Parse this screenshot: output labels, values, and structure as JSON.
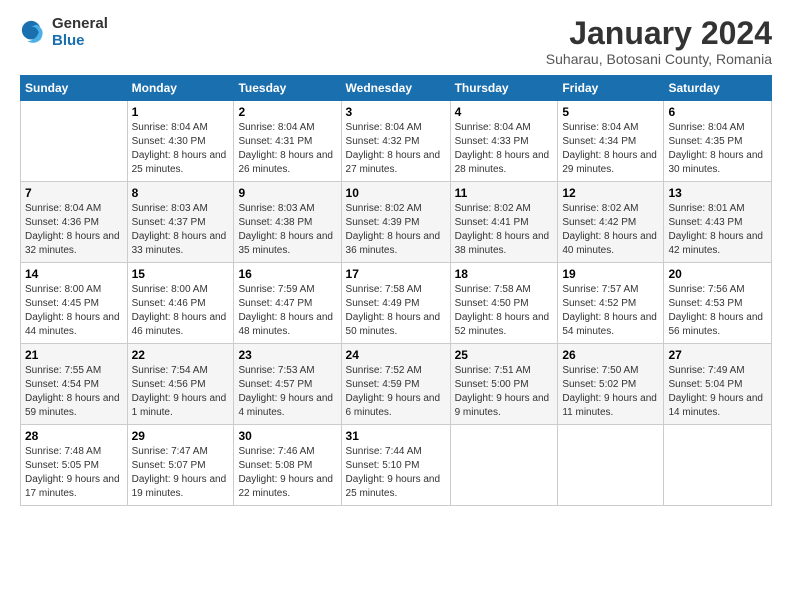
{
  "logo": {
    "general": "General",
    "blue": "Blue"
  },
  "header": {
    "month_year": "January 2024",
    "location": "Suharau, Botosani County, Romania"
  },
  "weekdays": [
    "Sunday",
    "Monday",
    "Tuesday",
    "Wednesday",
    "Thursday",
    "Friday",
    "Saturday"
  ],
  "weeks": [
    [
      {
        "day": "",
        "sunrise": "",
        "sunset": "",
        "daylight": ""
      },
      {
        "day": "1",
        "sunrise": "Sunrise: 8:04 AM",
        "sunset": "Sunset: 4:30 PM",
        "daylight": "Daylight: 8 hours and 25 minutes."
      },
      {
        "day": "2",
        "sunrise": "Sunrise: 8:04 AM",
        "sunset": "Sunset: 4:31 PM",
        "daylight": "Daylight: 8 hours and 26 minutes."
      },
      {
        "day": "3",
        "sunrise": "Sunrise: 8:04 AM",
        "sunset": "Sunset: 4:32 PM",
        "daylight": "Daylight: 8 hours and 27 minutes."
      },
      {
        "day": "4",
        "sunrise": "Sunrise: 8:04 AM",
        "sunset": "Sunset: 4:33 PM",
        "daylight": "Daylight: 8 hours and 28 minutes."
      },
      {
        "day": "5",
        "sunrise": "Sunrise: 8:04 AM",
        "sunset": "Sunset: 4:34 PM",
        "daylight": "Daylight: 8 hours and 29 minutes."
      },
      {
        "day": "6",
        "sunrise": "Sunrise: 8:04 AM",
        "sunset": "Sunset: 4:35 PM",
        "daylight": "Daylight: 8 hours and 30 minutes."
      }
    ],
    [
      {
        "day": "7",
        "sunrise": "Sunrise: 8:04 AM",
        "sunset": "Sunset: 4:36 PM",
        "daylight": "Daylight: 8 hours and 32 minutes."
      },
      {
        "day": "8",
        "sunrise": "Sunrise: 8:03 AM",
        "sunset": "Sunset: 4:37 PM",
        "daylight": "Daylight: 8 hours and 33 minutes."
      },
      {
        "day": "9",
        "sunrise": "Sunrise: 8:03 AM",
        "sunset": "Sunset: 4:38 PM",
        "daylight": "Daylight: 8 hours and 35 minutes."
      },
      {
        "day": "10",
        "sunrise": "Sunrise: 8:02 AM",
        "sunset": "Sunset: 4:39 PM",
        "daylight": "Daylight: 8 hours and 36 minutes."
      },
      {
        "day": "11",
        "sunrise": "Sunrise: 8:02 AM",
        "sunset": "Sunset: 4:41 PM",
        "daylight": "Daylight: 8 hours and 38 minutes."
      },
      {
        "day": "12",
        "sunrise": "Sunrise: 8:02 AM",
        "sunset": "Sunset: 4:42 PM",
        "daylight": "Daylight: 8 hours and 40 minutes."
      },
      {
        "day": "13",
        "sunrise": "Sunrise: 8:01 AM",
        "sunset": "Sunset: 4:43 PM",
        "daylight": "Daylight: 8 hours and 42 minutes."
      }
    ],
    [
      {
        "day": "14",
        "sunrise": "Sunrise: 8:00 AM",
        "sunset": "Sunset: 4:45 PM",
        "daylight": "Daylight: 8 hours and 44 minutes."
      },
      {
        "day": "15",
        "sunrise": "Sunrise: 8:00 AM",
        "sunset": "Sunset: 4:46 PM",
        "daylight": "Daylight: 8 hours and 46 minutes."
      },
      {
        "day": "16",
        "sunrise": "Sunrise: 7:59 AM",
        "sunset": "Sunset: 4:47 PM",
        "daylight": "Daylight: 8 hours and 48 minutes."
      },
      {
        "day": "17",
        "sunrise": "Sunrise: 7:58 AM",
        "sunset": "Sunset: 4:49 PM",
        "daylight": "Daylight: 8 hours and 50 minutes."
      },
      {
        "day": "18",
        "sunrise": "Sunrise: 7:58 AM",
        "sunset": "Sunset: 4:50 PM",
        "daylight": "Daylight: 8 hours and 52 minutes."
      },
      {
        "day": "19",
        "sunrise": "Sunrise: 7:57 AM",
        "sunset": "Sunset: 4:52 PM",
        "daylight": "Daylight: 8 hours and 54 minutes."
      },
      {
        "day": "20",
        "sunrise": "Sunrise: 7:56 AM",
        "sunset": "Sunset: 4:53 PM",
        "daylight": "Daylight: 8 hours and 56 minutes."
      }
    ],
    [
      {
        "day": "21",
        "sunrise": "Sunrise: 7:55 AM",
        "sunset": "Sunset: 4:54 PM",
        "daylight": "Daylight: 8 hours and 59 minutes."
      },
      {
        "day": "22",
        "sunrise": "Sunrise: 7:54 AM",
        "sunset": "Sunset: 4:56 PM",
        "daylight": "Daylight: 9 hours and 1 minute."
      },
      {
        "day": "23",
        "sunrise": "Sunrise: 7:53 AM",
        "sunset": "Sunset: 4:57 PM",
        "daylight": "Daylight: 9 hours and 4 minutes."
      },
      {
        "day": "24",
        "sunrise": "Sunrise: 7:52 AM",
        "sunset": "Sunset: 4:59 PM",
        "daylight": "Daylight: 9 hours and 6 minutes."
      },
      {
        "day": "25",
        "sunrise": "Sunrise: 7:51 AM",
        "sunset": "Sunset: 5:00 PM",
        "daylight": "Daylight: 9 hours and 9 minutes."
      },
      {
        "day": "26",
        "sunrise": "Sunrise: 7:50 AM",
        "sunset": "Sunset: 5:02 PM",
        "daylight": "Daylight: 9 hours and 11 minutes."
      },
      {
        "day": "27",
        "sunrise": "Sunrise: 7:49 AM",
        "sunset": "Sunset: 5:04 PM",
        "daylight": "Daylight: 9 hours and 14 minutes."
      }
    ],
    [
      {
        "day": "28",
        "sunrise": "Sunrise: 7:48 AM",
        "sunset": "Sunset: 5:05 PM",
        "daylight": "Daylight: 9 hours and 17 minutes."
      },
      {
        "day": "29",
        "sunrise": "Sunrise: 7:47 AM",
        "sunset": "Sunset: 5:07 PM",
        "daylight": "Daylight: 9 hours and 19 minutes."
      },
      {
        "day": "30",
        "sunrise": "Sunrise: 7:46 AM",
        "sunset": "Sunset: 5:08 PM",
        "daylight": "Daylight: 9 hours and 22 minutes."
      },
      {
        "day": "31",
        "sunrise": "Sunrise: 7:44 AM",
        "sunset": "Sunset: 5:10 PM",
        "daylight": "Daylight: 9 hours and 25 minutes."
      },
      {
        "day": "",
        "sunrise": "",
        "sunset": "",
        "daylight": ""
      },
      {
        "day": "",
        "sunrise": "",
        "sunset": "",
        "daylight": ""
      },
      {
        "day": "",
        "sunrise": "",
        "sunset": "",
        "daylight": ""
      }
    ]
  ]
}
